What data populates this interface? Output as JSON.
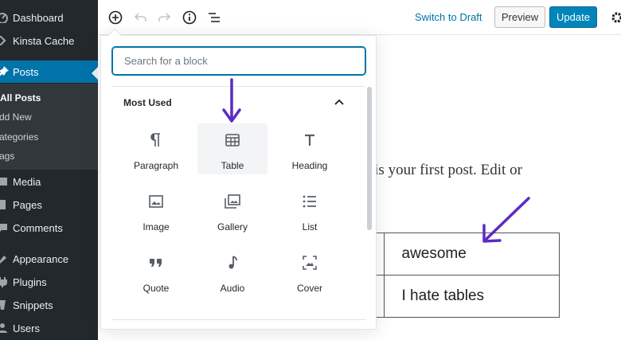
{
  "sidebar": {
    "items": [
      {
        "label": "Dashboard",
        "icon": "dashboard-icon"
      },
      {
        "label": "Kinsta Cache",
        "icon": "kinsta-icon"
      },
      {
        "label": "Posts",
        "icon": "pin-icon"
      },
      {
        "label": "Media",
        "icon": "media-icon"
      },
      {
        "label": "Pages",
        "icon": "pages-icon"
      },
      {
        "label": "Comments",
        "icon": "comments-icon"
      },
      {
        "label": "Appearance",
        "icon": "appearance-icon"
      },
      {
        "label": "Plugins",
        "icon": "plugins-icon"
      },
      {
        "label": "Snippets",
        "icon": "snippets-icon"
      },
      {
        "label": "Users",
        "icon": "users-icon"
      }
    ],
    "posts_submenu": [
      "All Posts",
      "Add New",
      "Categories",
      "Tags"
    ],
    "sub_visible": [
      "All Posts",
      "dd New",
      "ategories",
      "ags"
    ]
  },
  "toolbar": {
    "switch_to_draft": "Switch to Draft",
    "preview": "Preview",
    "update": "Update"
  },
  "inserter": {
    "search_placeholder": "Search for a block",
    "panel_title": "Most Used",
    "blocks": [
      {
        "label": "Paragraph",
        "icon": "paragraph-icon"
      },
      {
        "label": "Table",
        "icon": "table-icon"
      },
      {
        "label": "Heading",
        "icon": "heading-icon"
      },
      {
        "label": "Image",
        "icon": "image-icon"
      },
      {
        "label": "Gallery",
        "icon": "gallery-icon"
      },
      {
        "label": "List",
        "icon": "list-icon"
      },
      {
        "label": "Quote",
        "icon": "quote-icon"
      },
      {
        "label": "Audio",
        "icon": "audio-icon"
      },
      {
        "label": "Cover",
        "icon": "cover-icon"
      }
    ]
  },
  "content": {
    "paragraph_visible": "s is your first post. Edit or",
    "table_cells": [
      "awesome",
      "I hate tables"
    ]
  },
  "colors": {
    "sidebar_bg": "#23282d",
    "active_blue": "#0073aa",
    "update_button": "#0085ba",
    "annotation_arrow": "#5b2bc4"
  }
}
